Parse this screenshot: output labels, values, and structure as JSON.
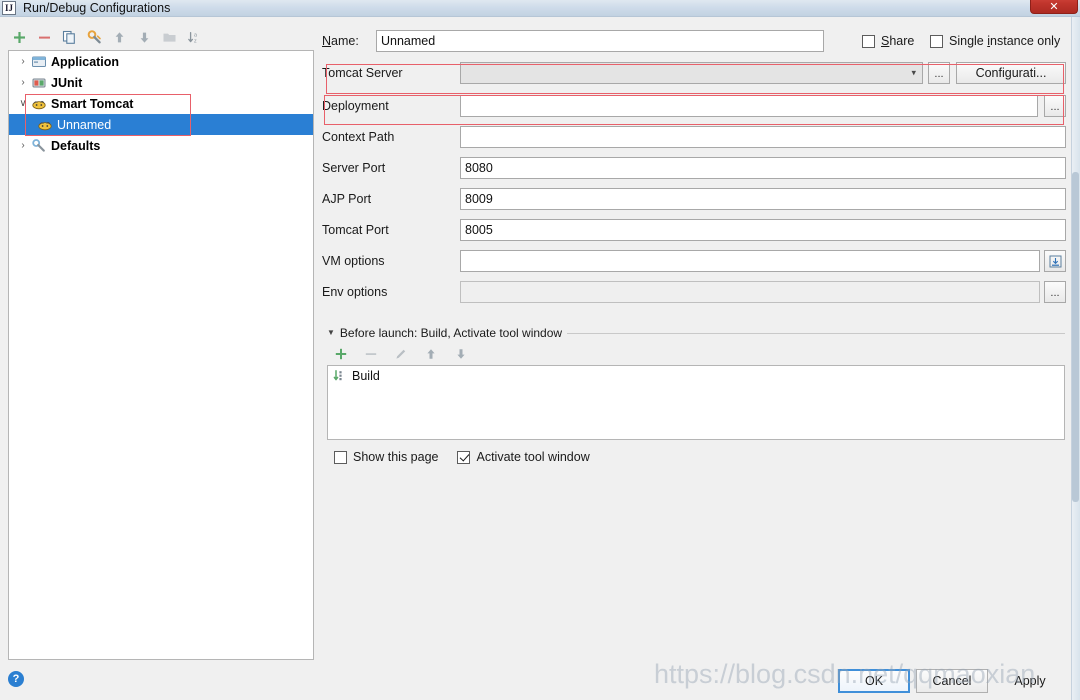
{
  "window": {
    "title": "Run/Debug Configurations",
    "app_icon": "intellij-idea-icon",
    "close_label": "✕"
  },
  "left_panel": {
    "toolbar": [
      {
        "name": "add-configuration-button",
        "icon": "plus-icon",
        "tooltip": "Add New Configuration"
      },
      {
        "name": "remove-configuration-button",
        "icon": "minus-icon",
        "tooltip": "Remove Configuration"
      },
      {
        "name": "copy-configuration-button",
        "icon": "copy-icon",
        "tooltip": "Copy Configuration"
      },
      {
        "name": "edit-templates-button",
        "icon": "wrench-icon",
        "tooltip": "Edit Templates"
      },
      {
        "name": "move-up-button",
        "icon": "arrow-up-icon",
        "tooltip": "Move Up"
      },
      {
        "name": "move-down-button",
        "icon": "arrow-down-icon",
        "tooltip": "Move Down"
      },
      {
        "name": "create-folder-button",
        "icon": "folder-icon",
        "tooltip": "Create New Folder"
      },
      {
        "name": "sort-configurations-button",
        "icon": "sort-az-icon",
        "tooltip": "Sort Configurations"
      }
    ],
    "tree": [
      {
        "label": "Application",
        "icon": "application-icon",
        "twisty": "›",
        "level": 0,
        "selected": false,
        "bold": true
      },
      {
        "label": "JUnit",
        "icon": "junit-icon",
        "twisty": "›",
        "level": 0,
        "selected": false,
        "bold": true
      },
      {
        "label": "Smart Tomcat",
        "icon": "tomcat-icon",
        "twisty": "∨",
        "level": 0,
        "selected": false,
        "bold": true
      },
      {
        "label": "Unnamed",
        "icon": "tomcat-icon",
        "twisty": "",
        "level": 1,
        "selected": true,
        "bold": false
      },
      {
        "label": "Defaults",
        "icon": "defaults-icon",
        "twisty": "›",
        "level": 0,
        "selected": false,
        "bold": true
      }
    ]
  },
  "form": {
    "name_label": "Name:",
    "name_value": "Unnamed",
    "name_placeholder": "",
    "share_label": "Share",
    "share_checked": false,
    "single_instance_label": "Single instance only",
    "single_instance_checked": false,
    "tomcat_server_label": "Tomcat Server",
    "tomcat_server_value": "",
    "tomcat_server_browse": "...",
    "configuration_button": "Configurati...",
    "deployment_label": "Deployment",
    "deployment_value": "",
    "deployment_browse": "...",
    "context_path_label": "Context Path",
    "context_path_value": "",
    "server_port_label": "Server Port",
    "server_port_value": "8080",
    "ajp_port_label": "AJP Port",
    "ajp_port_value": "8009",
    "tomcat_port_label": "Tomcat Port",
    "tomcat_port_value": "8005",
    "vm_options_label": "VM options",
    "vm_options_value": "",
    "vm_options_expand": "expand-icon",
    "env_options_label": "Env options",
    "env_options_value": "",
    "env_options_browse": "..."
  },
  "before_launch": {
    "header": "Before launch: Build, Activate tool window",
    "toolbar": [
      {
        "name": "add-task-button",
        "icon": "plus-icon"
      },
      {
        "name": "remove-task-button",
        "icon": "minus-icon"
      },
      {
        "name": "edit-task-button",
        "icon": "pencil-icon"
      },
      {
        "name": "move-task-up-button",
        "icon": "arrow-up-icon"
      },
      {
        "name": "move-task-down-button",
        "icon": "arrow-down-icon"
      }
    ],
    "tasks": [
      {
        "label": "Build",
        "icon": "build-icon"
      }
    ],
    "show_page_label": "Show this page",
    "show_page_checked": false,
    "activate_tool_window_label": "Activate tool window",
    "activate_tool_window_checked": true
  },
  "footer": {
    "help_label": "?",
    "ok_label": "OK",
    "cancel_label": "Cancel",
    "apply_label": "Apply"
  },
  "watermark": {
    "text": "https://blog.csdn.net/qqmaoxian"
  },
  "colors": {
    "selection_blue": "#2a7fd4",
    "annotation_red": "#e8606a",
    "accent_green": "#4caf50",
    "help_blue": "#2b7fd1",
    "title_bar": "#cfdcea"
  }
}
